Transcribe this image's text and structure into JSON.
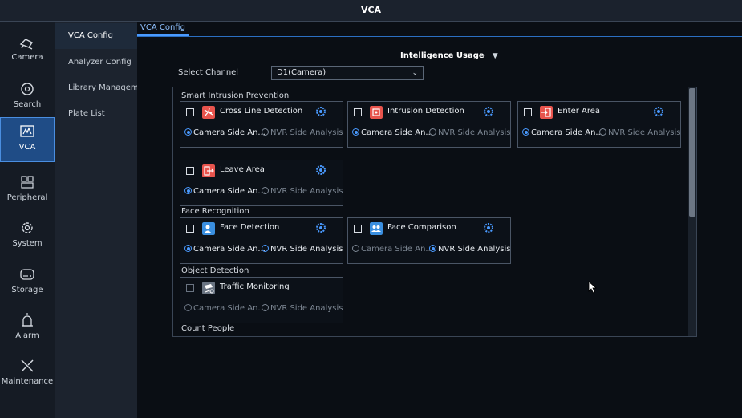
{
  "window": {
    "title": "VCA"
  },
  "leftnav": {
    "items": [
      {
        "label": "Camera",
        "icon": "camera-icon",
        "active": false
      },
      {
        "label": "Search",
        "icon": "search-icon",
        "active": false
      },
      {
        "label": "VCA",
        "icon": "vca-icon",
        "active": true
      },
      {
        "label": "Peripheral",
        "icon": "peripheral-icon",
        "active": false
      },
      {
        "label": "System",
        "icon": "system-gear-icon",
        "active": false
      },
      {
        "label": "Storage",
        "icon": "storage-icon",
        "active": false
      },
      {
        "label": "Alarm",
        "icon": "alarm-icon",
        "active": false
      },
      {
        "label": "Maintenance",
        "icon": "maintenance-icon",
        "active": false
      }
    ]
  },
  "subnav": {
    "items": [
      {
        "label": "VCA Config",
        "active": true
      },
      {
        "label": "Analyzer Config",
        "active": false
      },
      {
        "label": "Library Managem...",
        "active": false
      },
      {
        "label": "Plate List",
        "active": false
      }
    ]
  },
  "tabs": {
    "active": "VCA Config"
  },
  "header": {
    "usage_label": "Intelligence Usage"
  },
  "channel": {
    "label": "Select Channel",
    "value": "D1(Camera)"
  },
  "options": {
    "camera": "Camera Side An...",
    "nvr": "NVR Side Analysis"
  },
  "sections": {
    "intrusion": "Smart Intrusion Prevention",
    "face": "Face Recognition",
    "object": "Object Detection",
    "count": "Count People"
  },
  "features": {
    "cross_line": {
      "name": "Cross Line Detection",
      "color": "#e8544d",
      "selected": "camera"
    },
    "intrusion": {
      "name": "Intrusion Detection",
      "color": "#e8544d",
      "selected": "camera"
    },
    "enter_area": {
      "name": "Enter Area",
      "color": "#e8544d",
      "selected": "camera"
    },
    "leave_area": {
      "name": "Leave Area",
      "color": "#e8544d",
      "selected": "camera"
    },
    "face_detection": {
      "name": "Face Detection",
      "color": "#3a8fe0",
      "selected": "camera"
    },
    "face_comparison": {
      "name": "Face Comparison",
      "color": "#3a8fe0",
      "selected": "nvr"
    },
    "traffic": {
      "name": "Traffic Monitoring",
      "color": "#6a7482",
      "selected": "camera",
      "disabled": true
    }
  },
  "colors": {
    "accent": "#4a9aff",
    "active_nav": "#1f4c86",
    "background": "#0a0e14"
  }
}
